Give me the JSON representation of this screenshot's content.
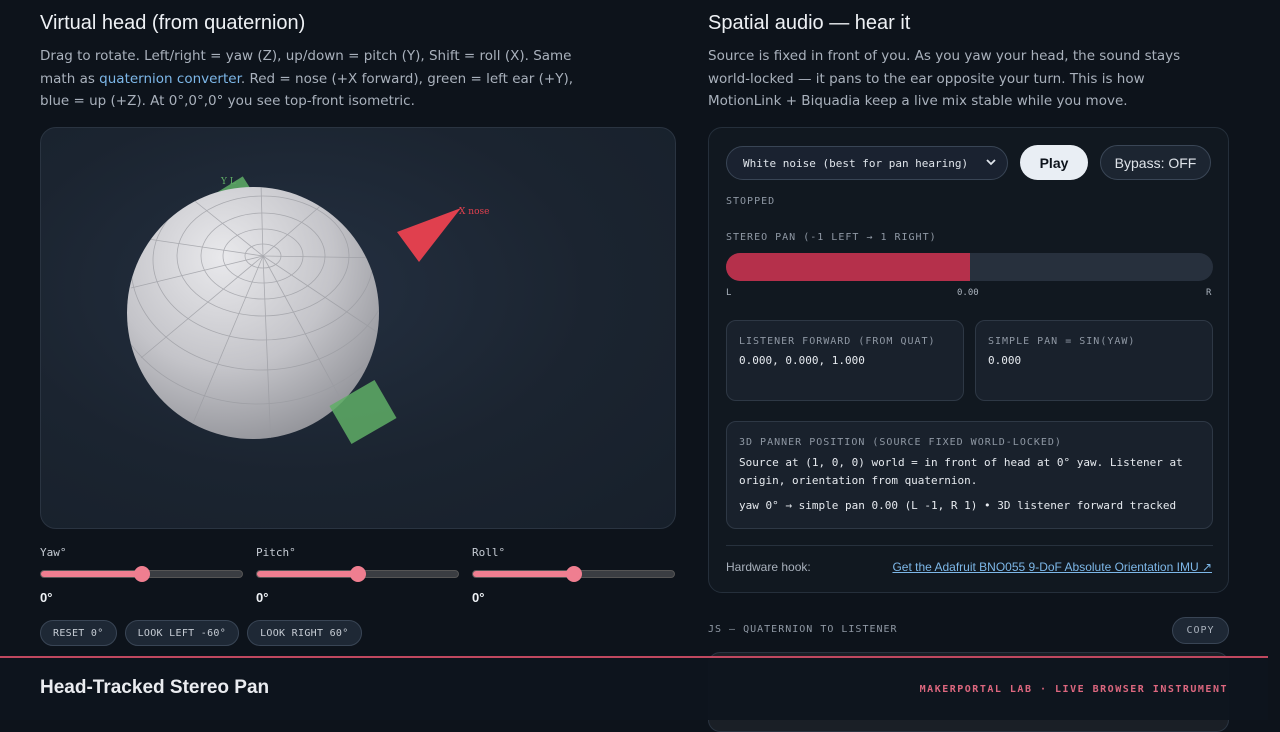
{
  "left": {
    "title": "Virtual head (from quaternion)",
    "desc_part1": "Drag to rotate. Left/right = yaw (Z), up/down = pitch (Y), Shift = roll (X). Same math as",
    "desc_link": "quaternion converter",
    "desc_part2": ". Red = nose (+X forward), green = left ear (+Y), blue = up (+Z). At 0°,0°,0° you see top-front isometric.",
    "viewer": {
      "nose_label": "X nose",
      "ear_label": "Y L"
    },
    "sliders": [
      {
        "label": "Yaw°",
        "value": "0°",
        "level": 0.5
      },
      {
        "label": "Pitch°",
        "value": "0°",
        "level": 0.5
      },
      {
        "label": "Roll°",
        "value": "0°",
        "level": 0.5
      }
    ],
    "presets": [
      "RESET 0°",
      "LOOK LEFT -60°",
      "LOOK RIGHT 60°"
    ]
  },
  "right": {
    "title": "Spatial audio — hear it",
    "desc": "Source is fixed in front of you. As you yaw your head, the sound stays world-locked — it pans to the ear opposite your turn. This is how MotionLink + Biquadia keep a live mix stable while you move.",
    "source_select": "White noise (best for pan hearing)",
    "play_label": "Play",
    "bypass_label": "Bypass: OFF",
    "status": "STOPPED",
    "pan_label": "STEREO PAN (-1 LEFT → 1 RIGHT)",
    "pan_value": 0.0,
    "pan_left": "L",
    "pan_center": "0.00",
    "pan_right": "R",
    "listener_title": "LISTENER FORWARD (FROM QUAT)",
    "listener_value": "0.000, 0.000, 1.000",
    "simple_title": "SIMPLE PAN = SIN(YAW)",
    "simple_value": "0.000",
    "panner_title": "3D PANNER POSITION (SOURCE FIXED WORLD-LOCKED)",
    "panner_text": "Source at (1, 0, 0) world = in front of head at 0° yaw. Listener at origin, orientation from quaternion.",
    "panner_status": "yaw 0° → simple pan 0.00 (L -1, R 1) • 3D listener forward tracked",
    "hardware_label": "Hardware hook:",
    "hardware_link": "Get the Adafruit BNO055 9-DoF Absolute Orientation IMU ↗",
    "js_label": "JS — QUATERNION TO LISTENER",
    "copy_label": "COPY"
  },
  "footer": {
    "title": "Head-Tracked Stereo Pan",
    "right": "MAKERPORTAL LAB · LIVE BROWSER INSTRUMENT"
  },
  "colors": {
    "accent": "#ef7e90",
    "pan_fill": "#b5304b",
    "link": "#7db7e8",
    "nose": "#e0404e",
    "ear": "#5fae66"
  }
}
